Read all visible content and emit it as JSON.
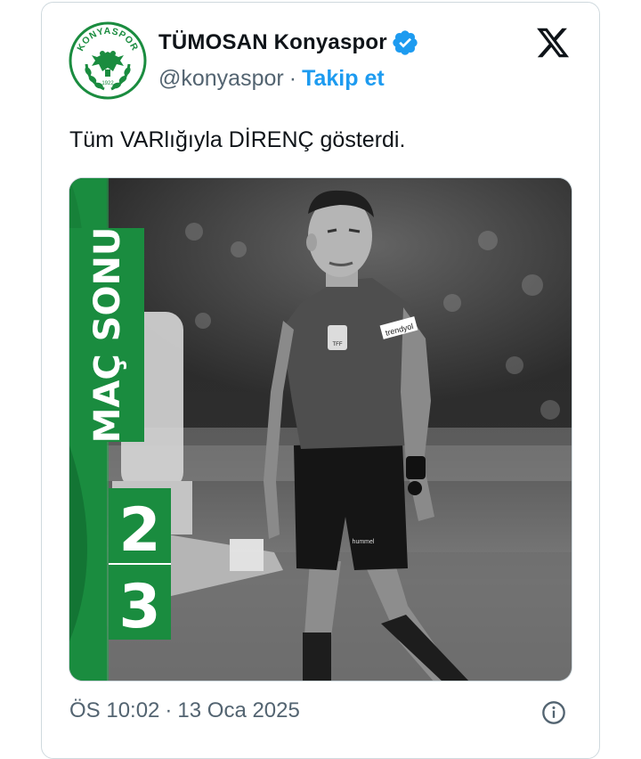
{
  "tweet": {
    "author": {
      "display_name": "TÜMOSAN Konyaspor",
      "handle": "@konyaspor",
      "follow_label": "Takip et",
      "logo_text_top": "KONYASPOR",
      "logo_year": "1922",
      "verified": true
    },
    "text": "Tüm VARlığıyla DİRENÇ gösterdi.",
    "media": {
      "banner_label": "MAÇ SONU",
      "score_home": "2",
      "score_away": "3",
      "badge_text": "TFF",
      "sleeve_text": "trendyol",
      "shorts_text": "hummel",
      "brand_green": "#1a8c3f",
      "dark_green": "#0c5e2a"
    },
    "time": "ÖS 10:02",
    "separator": "·",
    "date": "13 Oca 2025"
  },
  "icons": {
    "platform": "x-logo-icon",
    "verified": "verified-badge-icon",
    "info": "info-icon"
  }
}
